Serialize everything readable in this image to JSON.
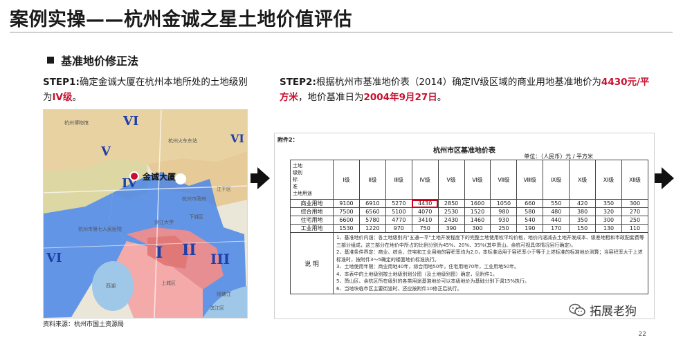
{
  "title": "案例实操——杭州金诚之星土地价值评估",
  "section": {
    "heading": "基准地价修正法"
  },
  "step1": {
    "label": "STEP1:",
    "text": "确定金诚大厦在杭州本地所处的土地级别为",
    "grade": "IV级",
    "end": "。"
  },
  "step2": {
    "label": "STEP2:",
    "text1": "根据杭州市基准地价表（2014）确定IV级区域的商业用地基准地价为",
    "price": "4430元/平方米",
    "text2": "，地价基准日为",
    "date": "2004年9月27日",
    "end": "。"
  },
  "map": {
    "marker_label": "金诚大厦",
    "zones": [
      "VI",
      "V",
      "VI",
      "IV",
      "I",
      "II",
      "III",
      "VI"
    ],
    "place_labels": [
      "杭州博物馆",
      "杭州火车东站",
      "杭州市第七人民医院",
      "浙江大学",
      "西湖",
      "上城区",
      "滨江区",
      "杭州市政府",
      "钱塘江",
      "下城区",
      "江干区"
    ],
    "source": "资料来源：杭州市国土资源局"
  },
  "table": {
    "attachment": "附件2：",
    "title": "杭州市区基准地价表",
    "unit": "单位：（人民币）元 / 平方米",
    "corner": [
      "土地",
      "级别",
      "标",
      "准",
      "土地用途"
    ],
    "grades": [
      "Ⅰ级",
      "Ⅱ级",
      "Ⅲ级",
      "Ⅳ级",
      "Ⅴ级",
      "Ⅵ级",
      "Ⅶ级",
      "Ⅷ级",
      "Ⅸ级",
      "Ⅹ级",
      "Ⅺ级",
      "Ⅻ级"
    ],
    "rows": [
      {
        "use": "商业用地",
        "values": [
          "9100",
          "6910",
          "5270",
          "4430",
          "2850",
          "1600",
          "1050",
          "660",
          "550",
          "420",
          "350",
          "300"
        ]
      },
      {
        "use": "综合用地",
        "values": [
          "7500",
          "6560",
          "5100",
          "4070",
          "2530",
          "1520",
          "980",
          "580",
          "480",
          "380",
          "320",
          "270"
        ]
      },
      {
        "use": "住宅用地",
        "values": [
          "6600",
          "5780",
          "4770",
          "3410",
          "2430",
          "1460",
          "930",
          "540",
          "440",
          "350",
          "300",
          "250"
        ]
      },
      {
        "use": "工业用地",
        "values": [
          "1530",
          "1220",
          "970",
          "750",
          "390",
          "300",
          "250",
          "190",
          "170",
          "150",
          "130",
          "110"
        ]
      }
    ],
    "notes_label": "说 明",
    "notes": [
      "1、基准地价内涵：各土地级别内\"五通一平\"土地开发程度下的完整土地使用权平均价格，地价内涵减去土地开发成本、级差地租和市政配套费等三部分组成，这三部分在地价中所占的比例分别为45%、20%、35%(其中萧山、余杭可视具体情况另行确定)。",
      "2、基准条件界定：商业、综合、住宅和工业用地的容积率均为2.0，本标准适用于容积率小于等于上述标准的标准地价测算；当容积率大于上述标准时，按附件3～5确定的楼面地价标准执行。",
      "3、土地使用年限：商业用地40年，综合用地50年，住宅用地70年，工业用地50年。",
      "4、本表中的土地级别按土地级别划分图（及土地级别图）确定，见附件1。",
      "5、萧山区、余杭区所在级别的各类用途基准地价可以本级地价为基础分别下调15%执行。",
      "6、当地块临市区主要街道时，还应按附件10修正后执行。"
    ]
  },
  "watermark": "拓展老狗",
  "page_number": "22"
}
